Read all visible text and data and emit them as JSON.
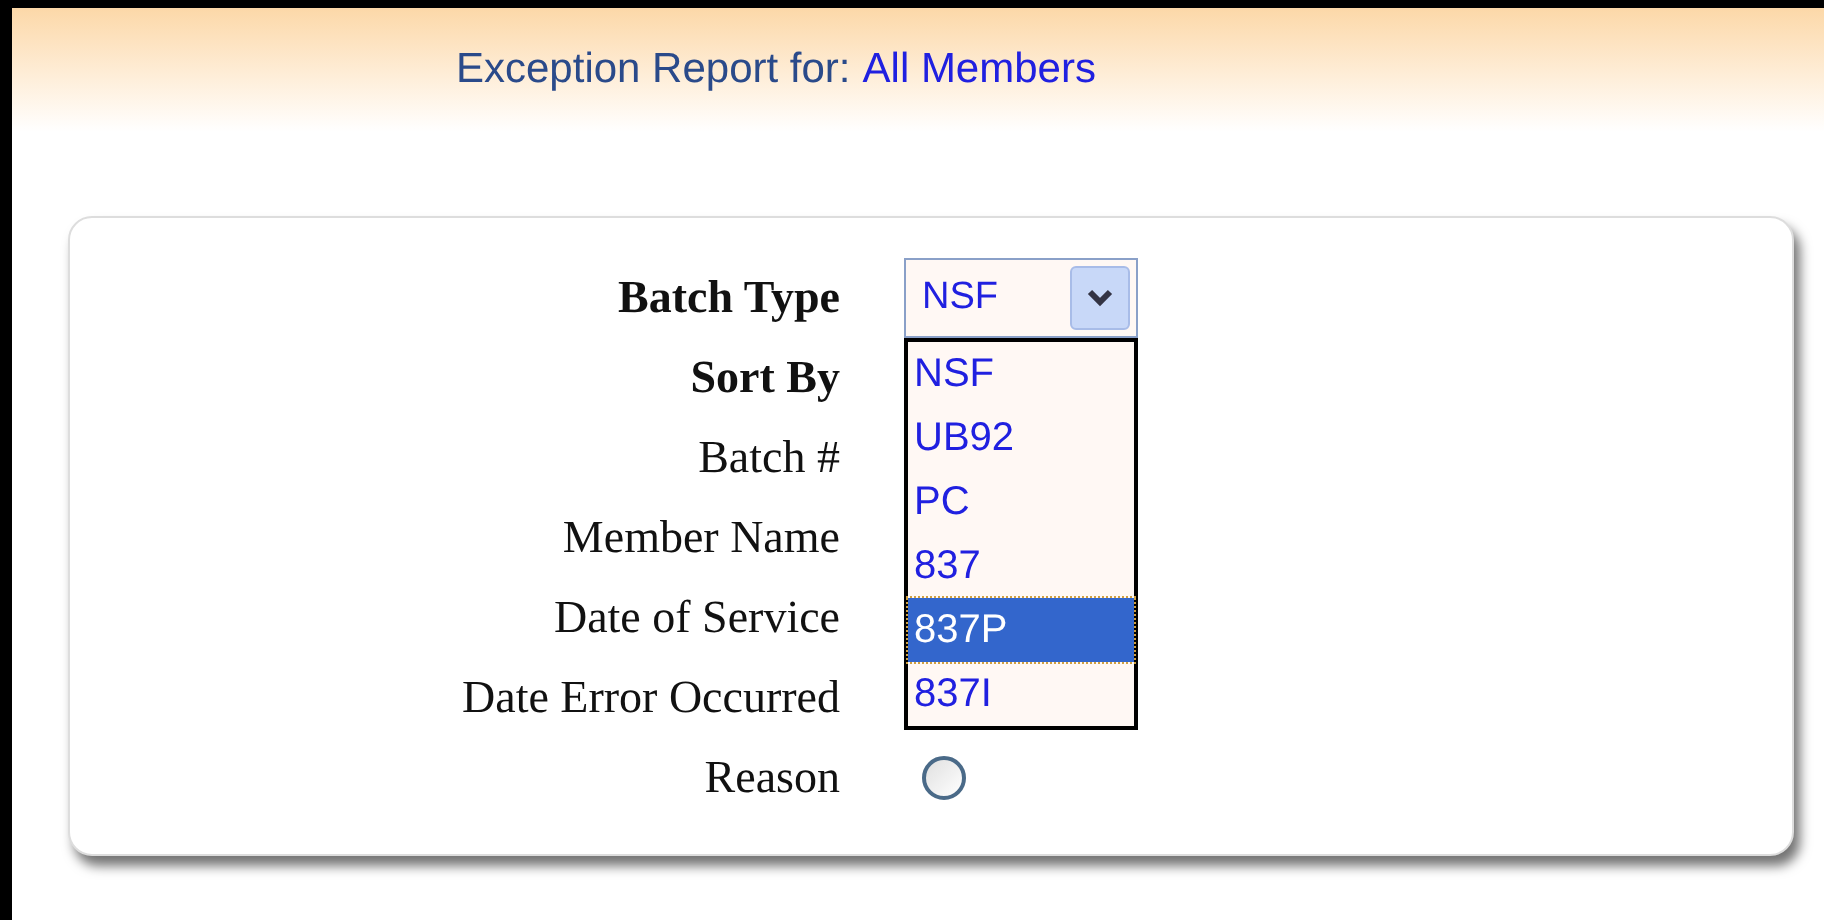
{
  "header": {
    "title": "Exception Report for:",
    "subject": "All Members"
  },
  "form": {
    "batch_type": {
      "label": "Batch Type",
      "value": "NSF",
      "options": [
        {
          "label": "NSF",
          "highlighted": false
        },
        {
          "label": "UB92",
          "highlighted": false
        },
        {
          "label": "PC",
          "highlighted": false
        },
        {
          "label": "837",
          "highlighted": false
        },
        {
          "label": "837P",
          "highlighted": true
        },
        {
          "label": "837I",
          "highlighted": false
        }
      ]
    },
    "sort_by": {
      "label": "Sort By",
      "options": [
        {
          "label": "Batch #"
        },
        {
          "label": "Member Name"
        },
        {
          "label": "Date of Service"
        },
        {
          "label": "Date Error Occurred"
        },
        {
          "label": "Reason",
          "radio": {
            "checked": false
          }
        }
      ]
    }
  }
}
